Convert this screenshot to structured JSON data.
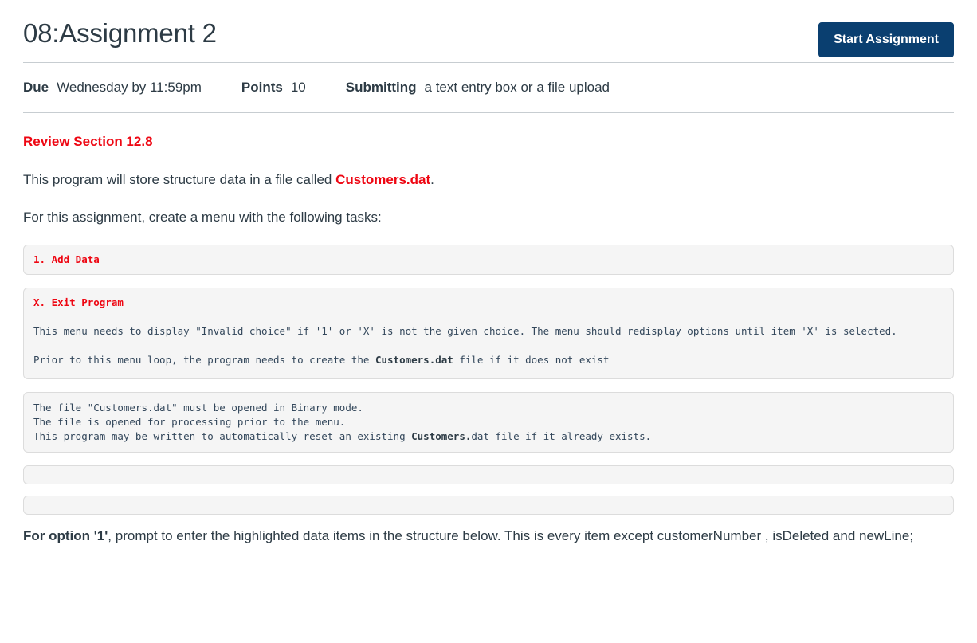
{
  "header": {
    "title": "08:Assignment 2",
    "start_button_label": "Start Assignment",
    "button_color": "#0a3f70"
  },
  "meta": {
    "due_label": "Due",
    "due_value": "Wednesday by 11:59pm",
    "points_label": "Points",
    "points_value": "10",
    "submitting_label": "Submitting",
    "submitting_value": "a text entry box or a file upload"
  },
  "description": {
    "heading": "Review Section 12.8",
    "heading_color": "#ee0612",
    "para1_before": "This program will store structure data in a file called ",
    "para1_file": "Customers.dat",
    "para1_after": ".",
    "para2": "For this assignment, create a menu with the following tasks:",
    "code_blocks": [
      {
        "id": "add-data",
        "menu_label": "1. Add Data"
      },
      {
        "id": "exit-program",
        "menu_label": "X. Exit Program",
        "line1": "This menu needs to display \"Invalid choice\" if '1' or 'X' is not the given choice. The menu should redisplay options until item 'X' is selected.",
        "line2_before": "Prior to this menu loop, the program needs to create the ",
        "line2_bold": "Customers.dat",
        "line2_after": " file if it does not exist"
      },
      {
        "id": "file-notes",
        "line1": "The file \"Customers.dat\" must be opened in Binary mode.",
        "line2": "The file is opened for processing prior to the menu.",
        "line3_before": "This program may be written to automatically reset an existing ",
        "line3_bold": "Customers.",
        "line3_after": "dat file if it already exists."
      },
      {
        "id": "empty-1",
        "text": ""
      },
      {
        "id": "empty-2",
        "text": ""
      }
    ],
    "para3_bold": "For option '1'",
    "para3_rest": ", prompt to enter the highlighted data items in the structure below. This is every item except customerNumber , isDeleted and newLine;"
  }
}
